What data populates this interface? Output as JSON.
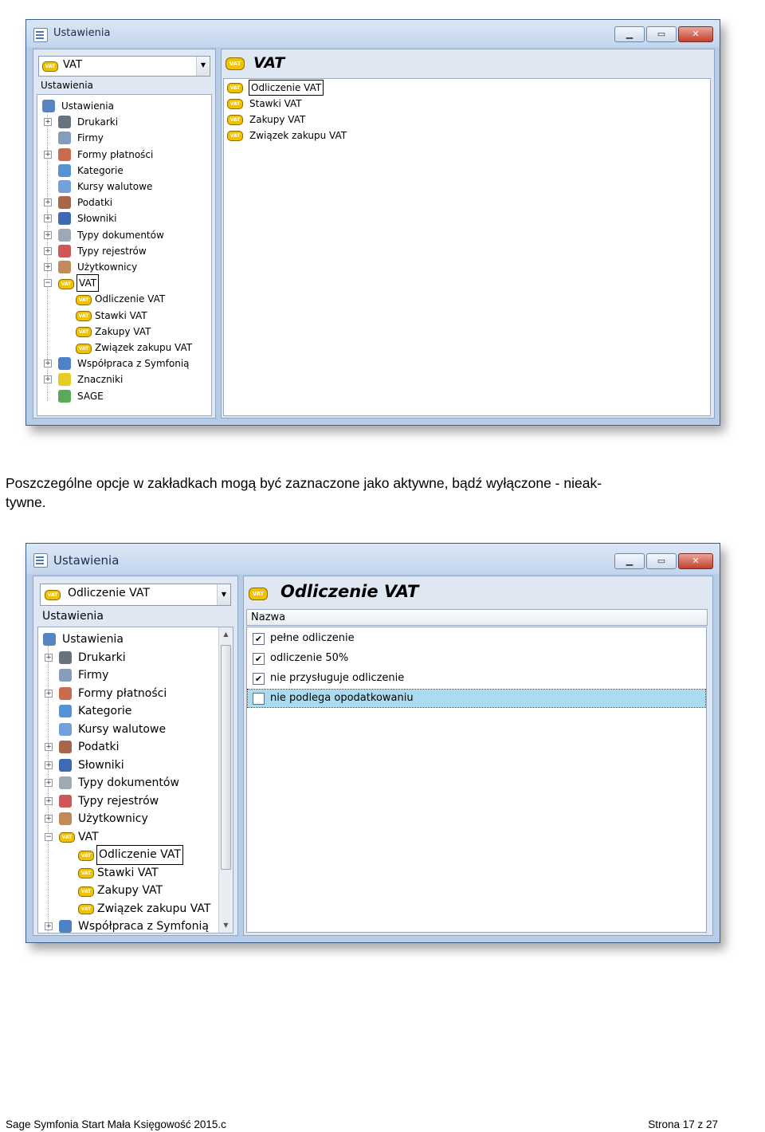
{
  "window1": {
    "title": "Ustawienia",
    "combo_value": "VAT",
    "section_label": "Ustawienia",
    "tree": [
      {
        "label": "Ustawienia",
        "icon": "tools-icon",
        "expander": ""
      },
      {
        "label": "Drukarki",
        "icon": "printer-icon",
        "expander": "+"
      },
      {
        "label": "Firmy",
        "icon": "company-icon",
        "expander": ""
      },
      {
        "label": "Formy płatności",
        "icon": "payment-icon",
        "expander": "+"
      },
      {
        "label": "Kategorie",
        "icon": "pie-chart-icon",
        "expander": ""
      },
      {
        "label": "Kursy walutowe",
        "icon": "chart-line-icon",
        "expander": ""
      },
      {
        "label": "Podatki",
        "icon": "tax-building-icon",
        "expander": "+"
      },
      {
        "label": "Słowniki",
        "icon": "dictionary-icon",
        "expander": "+"
      },
      {
        "label": "Typy dokumentów",
        "icon": "document-types-icon",
        "expander": "+"
      },
      {
        "label": "Typy rejestrów",
        "icon": "register-icon",
        "expander": "+"
      },
      {
        "label": "Użytkownicy",
        "icon": "users-icon",
        "expander": "+"
      },
      {
        "label": "VAT",
        "icon": "vat-icon",
        "expander": "−"
      },
      {
        "label": "Odliczenie VAT",
        "icon": "vat-icon",
        "expander": "",
        "child": true
      },
      {
        "label": "Stawki VAT",
        "icon": "vat-icon",
        "expander": "",
        "child": true
      },
      {
        "label": "Zakupy VAT",
        "icon": "vat-icon",
        "expander": "",
        "child": true
      },
      {
        "label": "Związek zakupu VAT",
        "icon": "vat-icon",
        "expander": "",
        "child": true
      },
      {
        "label": "Współpraca z Symfonią",
        "icon": "sync-icon",
        "expander": "+"
      },
      {
        "label": "Znaczniki",
        "icon": "marker-icon",
        "expander": "+"
      },
      {
        "label": "SAGE",
        "icon": "sage-icon",
        "expander": ""
      }
    ],
    "right_title": "VAT",
    "right_items": [
      "Odliczenie VAT",
      "Stawki VAT",
      "Zakupy VAT",
      "Związek zakupu VAT"
    ]
  },
  "paragraph": "Poszczególne opcje w zakładkach mogą być zaznaczone jako aktywne, bądź wyłączone - nieak-",
  "paragraph_line2": "tywne.",
  "window2": {
    "title": "Ustawienia",
    "combo_value": "Odliczenie VAT",
    "section_label": "Ustawienia",
    "tree": [
      {
        "label": "Ustawienia",
        "icon": "tools-icon",
        "expander": ""
      },
      {
        "label": "Drukarki",
        "icon": "printer-icon",
        "expander": "+"
      },
      {
        "label": "Firmy",
        "icon": "company-icon",
        "expander": ""
      },
      {
        "label": "Formy płatności",
        "icon": "payment-icon",
        "expander": "+"
      },
      {
        "label": "Kategorie",
        "icon": "pie-chart-icon",
        "expander": ""
      },
      {
        "label": "Kursy walutowe",
        "icon": "chart-line-icon",
        "expander": ""
      },
      {
        "label": "Podatki",
        "icon": "tax-building-icon",
        "expander": "+"
      },
      {
        "label": "Słowniki",
        "icon": "dictionary-icon",
        "expander": "+"
      },
      {
        "label": "Typy dokumentów",
        "icon": "document-types-icon",
        "expander": "+"
      },
      {
        "label": "Typy rejestrów",
        "icon": "register-icon",
        "expander": "+"
      },
      {
        "label": "Użytkownicy",
        "icon": "users-icon",
        "expander": "+"
      },
      {
        "label": "VAT",
        "icon": "vat-icon",
        "expander": "−"
      },
      {
        "label": "Odliczenie VAT",
        "icon": "vat-icon",
        "expander": "",
        "child": true
      },
      {
        "label": "Stawki VAT",
        "icon": "vat-icon",
        "expander": "",
        "child": true
      },
      {
        "label": "Zakupy VAT",
        "icon": "vat-icon",
        "expander": "",
        "child": true
      },
      {
        "label": "Związek zakupu VAT",
        "icon": "vat-icon",
        "expander": "",
        "child": true
      },
      {
        "label": "Współpraca z Symfonią",
        "icon": "sync-icon",
        "expander": "+"
      }
    ],
    "right_title": "Odliczenie VAT",
    "column_header": "Nazwa",
    "options": [
      {
        "label": "pełne odliczenie",
        "checked": true,
        "selected": false
      },
      {
        "label": "odliczenie 50%",
        "checked": true,
        "selected": false
      },
      {
        "label": "nie przysługuje odliczenie",
        "checked": true,
        "selected": false
      },
      {
        "label": "nie podlega opodatkowaniu",
        "checked": false,
        "selected": true
      }
    ]
  },
  "footer": {
    "left": "Sage Symfonia Start Mała Księgowość 2015.c",
    "right": "Strona 17 z 27"
  },
  "icon_badge_text": "VAT"
}
